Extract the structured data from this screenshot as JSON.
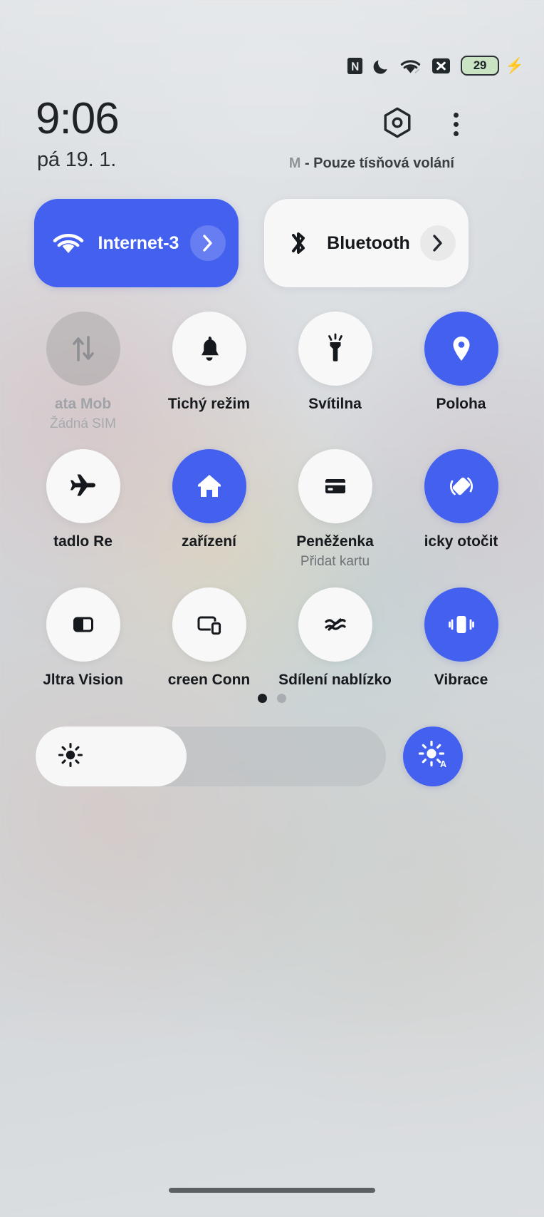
{
  "status_bar": {
    "icons": [
      "nfc-icon",
      "dnd-moon-icon",
      "wifi-icon",
      "no-sim-icon"
    ],
    "battery_percent": "29",
    "charging": true
  },
  "header": {
    "clock": "9:06",
    "date": "pá 19. 1.",
    "carrier_prefix": "M",
    "carrier_text": "- Pouze tísňová volání",
    "settings_icon": "hex-gear-icon",
    "overflow_icon": "more-vertical-icon"
  },
  "big_tiles": [
    {
      "name": "internet",
      "label": "Internet-3",
      "icon": "wifi-icon",
      "state": "on",
      "chevron": "chevron-right-icon"
    },
    {
      "name": "bluetooth",
      "label": "Bluetooth",
      "icon": "bluetooth-icon",
      "state": "off",
      "chevron": "chevron-right-icon"
    }
  ],
  "toggles": [
    {
      "name": "mobile-data",
      "label": "ata      Mob",
      "sub": "Žádná SIM",
      "icon": "data-transfer-icon",
      "state": "disabled"
    },
    {
      "name": "silent-mode",
      "label": "Tichý režim",
      "sub": "",
      "icon": "bell-icon",
      "state": "off"
    },
    {
      "name": "flashlight",
      "label": "Svítilna",
      "sub": "",
      "icon": "flashlight-icon",
      "state": "off"
    },
    {
      "name": "location",
      "label": "Poloha",
      "sub": "",
      "icon": "location-pin-icon",
      "state": "on"
    },
    {
      "name": "airplane-mode",
      "label": "tadlo     Re",
      "sub": "",
      "icon": "airplane-icon",
      "state": "off"
    },
    {
      "name": "smart-devices",
      "label": "zařízení",
      "sub": "",
      "icon": "home-icon",
      "state": "on"
    },
    {
      "name": "wallet",
      "label": "Peněženka",
      "sub": "Přidat kartu",
      "icon": "credit-card-icon",
      "state": "off"
    },
    {
      "name": "auto-rotate",
      "label": "icky otočit",
      "sub": "",
      "icon": "auto-rotate-icon",
      "state": "on"
    },
    {
      "name": "ultra-vision",
      "label": "Jltra Vision",
      "sub": "",
      "icon": "split-panel-icon",
      "state": "off"
    },
    {
      "name": "screen-connect",
      "label": "creen Conn",
      "sub": "",
      "icon": "cast-devices-icon",
      "state": "off"
    },
    {
      "name": "nearby-share",
      "label": "Sdílení nablízko",
      "sub": "",
      "icon": "nearby-share-icon",
      "state": "off"
    },
    {
      "name": "vibrate",
      "label": "Vibrace",
      "sub": "",
      "icon": "vibrate-icon",
      "state": "on"
    }
  ],
  "pager": {
    "total": 2,
    "active_index": 0
  },
  "brightness": {
    "value_percent": 43,
    "icon": "brightness-sun-icon",
    "auto_icon": "brightness-auto-icon"
  },
  "colors": {
    "accent": "#4360ee",
    "tile_off": "#f7f7f7",
    "text_primary": "#16191d",
    "text_muted": "#6e7276",
    "battery_green": "#2bbd3a"
  }
}
